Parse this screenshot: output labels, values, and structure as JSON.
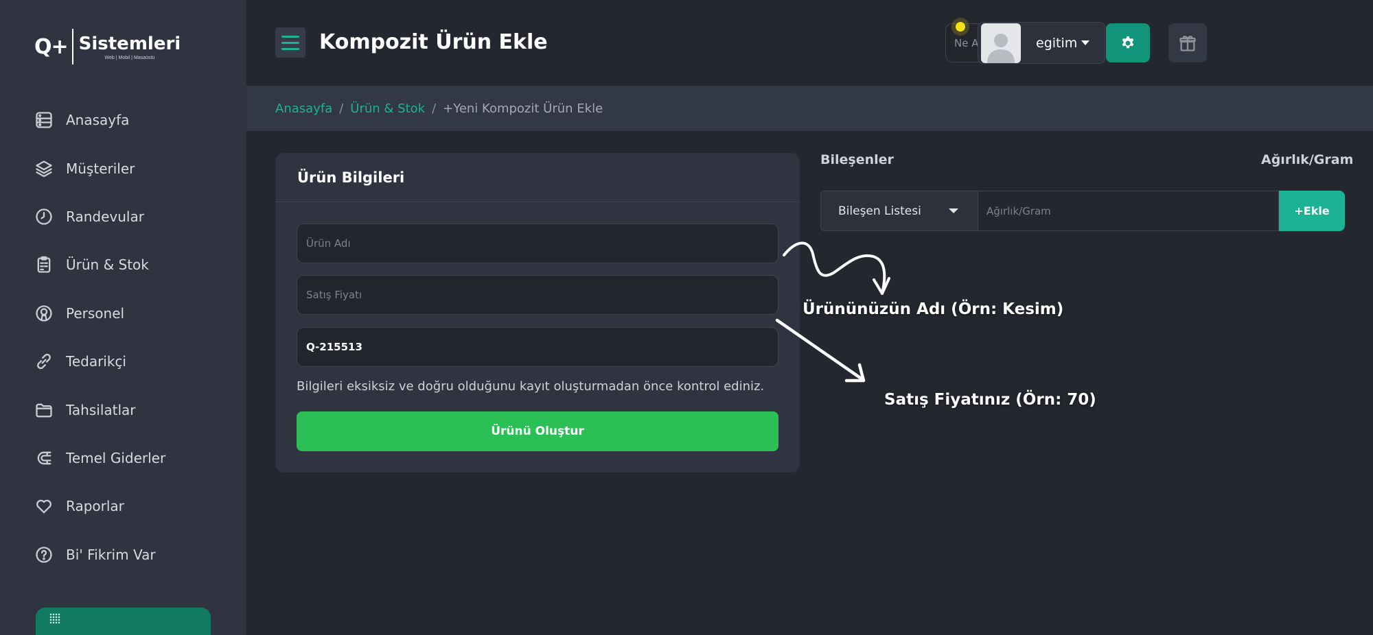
{
  "logo": {
    "mark": "Q+",
    "name": "Sistemleri",
    "subtitle": "Web | Mobil | Masaüstü"
  },
  "sidebar": {
    "items": [
      {
        "label": "Anasayfa",
        "icon": "dashboard-icon"
      },
      {
        "label": "Müşteriler",
        "icon": "layers-icon"
      },
      {
        "label": "Randevular",
        "icon": "clock-icon"
      },
      {
        "label": "Ürün & Stok",
        "icon": "clipboard-icon"
      },
      {
        "label": "Personel",
        "icon": "user-circle-icon"
      },
      {
        "label": "Tedarikçi",
        "icon": "link-icon"
      },
      {
        "label": "Tahsilatlar",
        "icon": "folder-icon"
      },
      {
        "label": "Temel Giderler",
        "icon": "magnet-icon"
      },
      {
        "label": "Raporlar",
        "icon": "heart-icon"
      },
      {
        "label": "Bi' Fikrim Var",
        "icon": "help-circle-icon"
      }
    ]
  },
  "header": {
    "title": "Kompozit Ürün Ekle",
    "search_placeholder": "Ne Aramıştınız?",
    "user_name": "egitim"
  },
  "breadcrumb": {
    "items": [
      "Anasayfa",
      "Ürün & Stok"
    ],
    "current": "+Yeni Kompozit Ürün Ekle",
    "separator": "/"
  },
  "product_card": {
    "title": "Ürün Bilgileri",
    "name_placeholder": "Ürün Adı",
    "price_placeholder": "Satış Fiyatı",
    "code_value": "Q-215513",
    "hint": "Bilgileri eksiksiz ve doğru olduğunu kayıt oluşturmadan önce kontrol ediniz.",
    "create_label": "Ürünü Oluştur"
  },
  "components": {
    "title": "Bileşenler",
    "weight_title": "Ağırlık/Gram",
    "select_label": "Bileşen Listesi",
    "weight_placeholder": "Ağırlık/Gram",
    "add_label": "+Ekle"
  },
  "annotations": {
    "name_hint": "Ürününüzün Adı (Örn: Kesim)",
    "price_hint": "Satış Fiyatınız (Örn: 70)"
  },
  "colors": {
    "accent": "#1bb394",
    "create_button": "#2bbf55",
    "sidebar_bg": "#2f3440",
    "page_bg": "#24272f",
    "notification": "#f4e21b"
  }
}
